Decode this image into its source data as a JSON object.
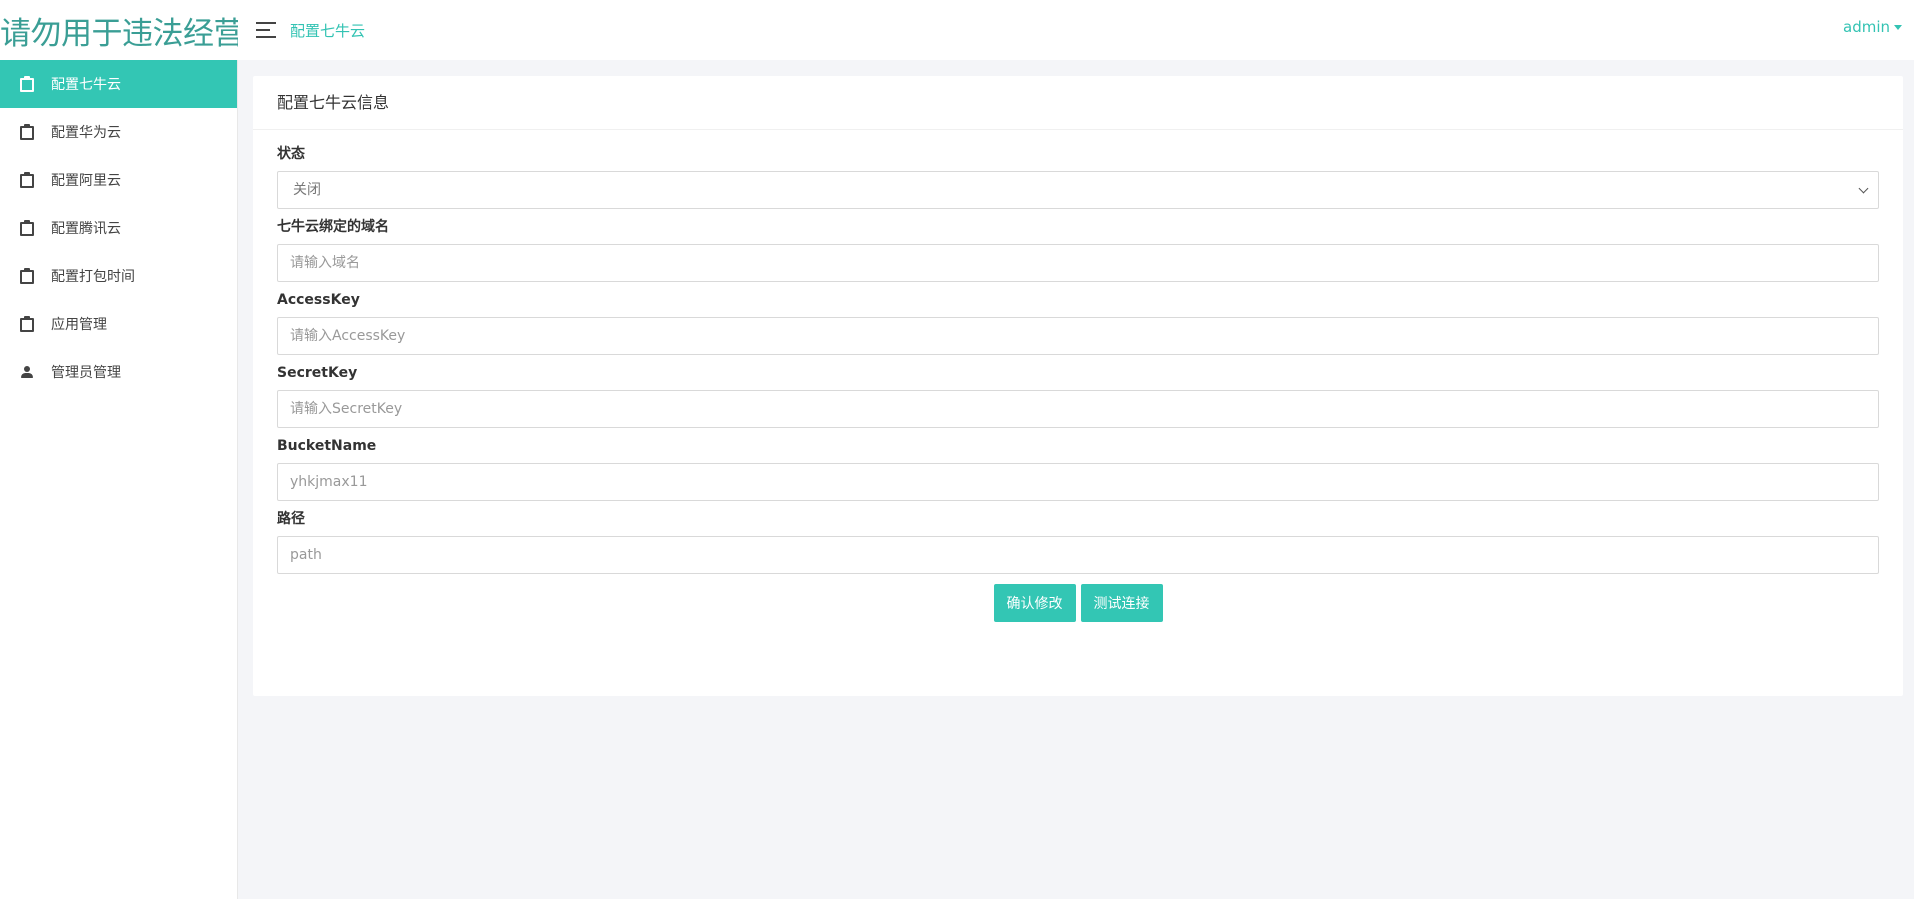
{
  "header": {
    "brand": "请勿用于违法经营",
    "breadcrumb": "配置七牛云",
    "user": "admin"
  },
  "sidebar": {
    "items": [
      {
        "label": "配置七牛云",
        "icon": "clipboard-icon",
        "active": true
      },
      {
        "label": "配置华为云",
        "icon": "clipboard-icon",
        "active": false
      },
      {
        "label": "配置阿里云",
        "icon": "clipboard-icon",
        "active": false
      },
      {
        "label": "配置腾讯云",
        "icon": "clipboard-icon",
        "active": false
      },
      {
        "label": "配置打包时间",
        "icon": "clipboard-icon",
        "active": false
      },
      {
        "label": "应用管理",
        "icon": "clipboard-icon",
        "active": false
      },
      {
        "label": "管理员管理",
        "icon": "person-icon",
        "active": false
      }
    ]
  },
  "card": {
    "title": "配置七牛云信息"
  },
  "form": {
    "status": {
      "label": "状态",
      "selected": "关闭"
    },
    "domain": {
      "label": "七牛云绑定的域名",
      "placeholder": "请输入域名",
      "value": ""
    },
    "access_key": {
      "label": "AccessKey",
      "placeholder": "请输入AccessKey",
      "value": ""
    },
    "secret_key": {
      "label": "SecretKey",
      "placeholder": "请输入SecretKey",
      "value": ""
    },
    "bucket_name": {
      "label": "BucketName",
      "placeholder": "yhkjmax11",
      "value": ""
    },
    "path": {
      "label": "路径",
      "placeholder": "path",
      "value": ""
    }
  },
  "actions": {
    "confirm": "确认修改",
    "test": "测试连接"
  },
  "colors": {
    "accent": "#33c6b4",
    "brand": "#3a9e95",
    "background": "#f4f5f8"
  }
}
